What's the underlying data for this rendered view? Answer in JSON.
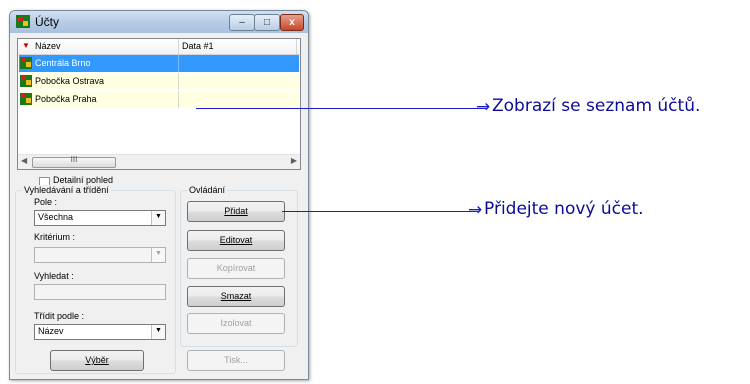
{
  "window": {
    "title": "Účty",
    "buttons": {
      "minimize": "–",
      "maximize": "□",
      "close": "x"
    }
  },
  "list": {
    "columns": [
      {
        "label": "Název",
        "sort": "▼"
      },
      {
        "label": "Data #1"
      }
    ],
    "rows": [
      {
        "name": "Centrála Brno",
        "selected": true
      },
      {
        "name": "Pobočka Ostrava",
        "selected": false
      },
      {
        "name": "Pobočka Praha",
        "selected": false
      }
    ],
    "scroll_thumb_glyph": "III"
  },
  "detail_view": {
    "label": "Detailní pohled",
    "checked": false
  },
  "search": {
    "group_title": "Vyhledávání a třídění",
    "field_label": "Pole :",
    "field_value": "Všechna",
    "criterion_label": "Kritérium :",
    "find_label": "Vyhledat :",
    "sort_label": "Třídit podle :",
    "sort_value": "Název",
    "select_button": "Výběr"
  },
  "controls": {
    "group_title": "Ovládání",
    "add": "Přidat",
    "edit": "Editovat",
    "copy": "Kopírovat",
    "delete": "Smazat",
    "isolate": "Izolovat",
    "print": "Tisk..."
  },
  "annotations": [
    {
      "text": "Zobrazí se seznam účtů."
    },
    {
      "text": "Přidejte nový účet."
    }
  ],
  "colors": {
    "selection": "#3399ff",
    "row_alt": "#ffffe1",
    "callout": "#1c1ccf"
  }
}
